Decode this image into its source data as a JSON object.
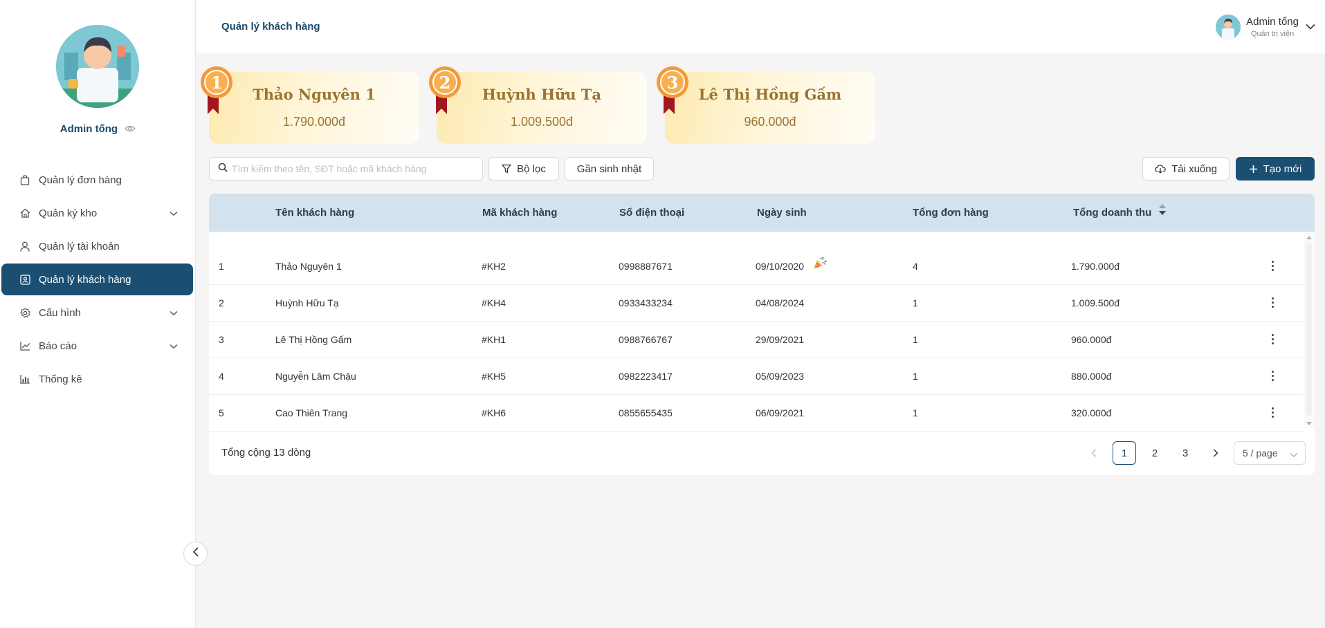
{
  "sidebar": {
    "profile_name": "Admin tổng",
    "items": [
      {
        "label": "Quản lý đơn hàng"
      },
      {
        "label": "Quản ký kho"
      },
      {
        "label": "Quản lý tài khoản"
      },
      {
        "label": "Quản lý khách hàng"
      },
      {
        "label": "Cấu hình"
      },
      {
        "label": "Báo cáo"
      },
      {
        "label": "Thống kê"
      }
    ]
  },
  "header": {
    "title": "Quản lý khách hàng",
    "user_name": "Admin tổng",
    "user_role": "Quản trị viên"
  },
  "top_customers": [
    {
      "rank": "1",
      "name": "Thảo Nguyên 1",
      "amount": "1.790.000đ"
    },
    {
      "rank": "2",
      "name": "Huỳnh Hữu Tạ",
      "amount": "1.009.500đ"
    },
    {
      "rank": "3",
      "name": "Lê Thị Hồng Gấm",
      "amount": "960.000đ"
    }
  ],
  "toolbar": {
    "search_placeholder": "Tìm kiếm theo tên, SĐT hoặc mã khách hàng",
    "filter_label": "Bộ lọc",
    "birthday_label": "Gần sinh nhật",
    "download_label": "Tải xuống",
    "create_label": "Tạo mới"
  },
  "table": {
    "columns": [
      "Tên khách hàng",
      "Mã khách hàng",
      "Số điện thoại",
      "Ngày sinh",
      "Tổng đơn hàng",
      "Tổng doanh thu"
    ],
    "rows": [
      {
        "no": "1",
        "name": "Thảo Nguyên 1",
        "code": "#KH2",
        "phone": "0998887671",
        "birthday": "09/10/2020",
        "orders": "4",
        "revenue": "1.790.000đ"
      },
      {
        "no": "2",
        "name": "Huỳnh Hữu Tạ",
        "code": "#KH4",
        "phone": "0933433234",
        "birthday": "04/08/2024",
        "orders": "1",
        "revenue": "1.009.500đ"
      },
      {
        "no": "3",
        "name": "Lê Thị Hồng Gấm",
        "code": "#KH1",
        "phone": "0988766767",
        "birthday": "29/09/2021",
        "orders": "1",
        "revenue": "960.000đ"
      },
      {
        "no": "4",
        "name": "Nguyễn Lâm Châu",
        "code": "#KH5",
        "phone": "0982223417",
        "birthday": "05/09/2023",
        "orders": "1",
        "revenue": "880.000đ"
      },
      {
        "no": "5",
        "name": "Cao Thiên Trang",
        "code": "#KH6",
        "phone": "0855655435",
        "birthday": "06/09/2021",
        "orders": "1",
        "revenue": "320.000đ"
      }
    ]
  },
  "footer": {
    "total_text": "Tổng cộng 13 dòng",
    "pages": [
      "1",
      "2",
      "3"
    ],
    "current_page": "1",
    "page_size": "5 / page"
  },
  "colors": {
    "primary": "#1b4f72",
    "header_row": "#d3e2ed",
    "gold_text": "#9b7433",
    "medal_orange": "#f29a3a",
    "ribbon_red": "#a3151f"
  }
}
